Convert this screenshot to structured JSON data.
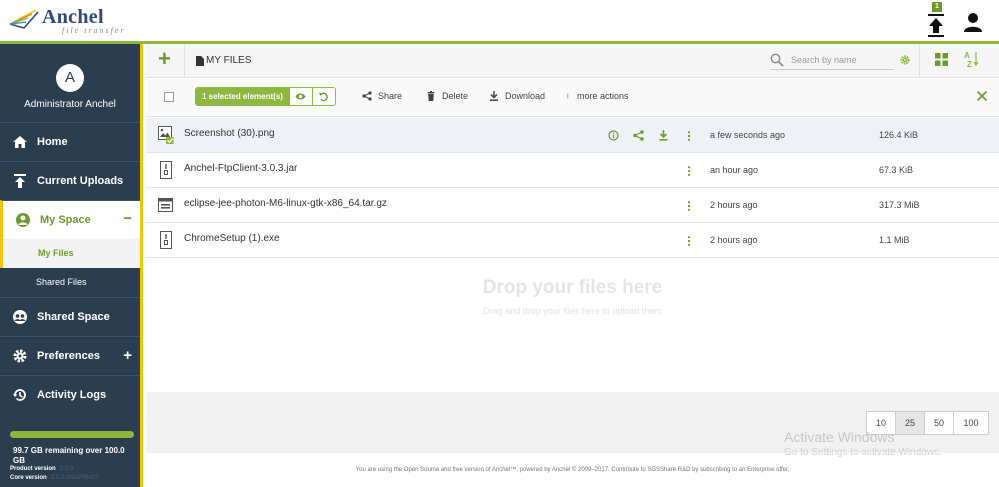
{
  "header": {
    "logo_name": "Anchel",
    "logo_subtitle": "file transfer",
    "upload_badge": "1"
  },
  "sidebar": {
    "avatar_letter": "A",
    "user_name": "Administrator Anchel",
    "items": [
      {
        "label": "Home",
        "icon": "home-icon"
      },
      {
        "label": "Current Uploads",
        "icon": "upload-icon"
      },
      {
        "label": "My Space",
        "icon": "user-circle-icon",
        "active": true
      },
      {
        "label": "Shared Space",
        "icon": "users-icon"
      },
      {
        "label": "Preferences",
        "icon": "gear-icon"
      },
      {
        "label": "Activity Logs",
        "icon": "history-icon"
      }
    ],
    "sub_items": [
      {
        "label": "My Files",
        "active": true
      },
      {
        "label": "Shared Files"
      }
    ],
    "quota_fraction": 1.0,
    "quota_text": "99.7 GB remaining over 100.0 GB",
    "product_version_label": "Product version",
    "product_version_value": "2.0.0",
    "core_version_label": "Core version",
    "core_version_value": "2.0.0-SNAPSHOT"
  },
  "toolbar": {
    "breadcrumb": "MY FILES",
    "search_placeholder": "Search by name"
  },
  "actions": {
    "selected_label": "1 selected element(s)",
    "share": "Share",
    "delete": "Delete",
    "download": "Download",
    "more": "more actions"
  },
  "files": [
    {
      "name": "Screenshot (30).png",
      "date": "a few seconds ago",
      "size": "126.4 KiB",
      "type": "image",
      "selected": true
    },
    {
      "name": "Anchel-FtpClient-3.0.3.jar",
      "date": "an hour ago",
      "size": "67.3 KiB",
      "type": "archive"
    },
    {
      "name": "eclipse-jee-photon-M6-linux-gtk-x86_64.tar.gz",
      "date": "2 hours ago",
      "size": "317.3 MiB",
      "type": "archive-box"
    },
    {
      "name": "ChromeSetup (1).exe",
      "date": "2 hours ago",
      "size": "1.1 MiB",
      "type": "archive"
    }
  ],
  "dropzone": {
    "title": "Drop your files here",
    "subtitle": "Drag and drop your files here to upload them"
  },
  "pager": [
    "10",
    "25",
    "50",
    "100"
  ],
  "pager_active": "25",
  "watermark": {
    "line1": "Activate Windows",
    "line2": "Go to Settings to activate Windows."
  },
  "footer": "You are using the Open Source and free version of Anchel™, powered by Anchel © 2009–2017. Contribute to SGSShare R&D by subscribing to an Enterprise offer.",
  "colors": {
    "accent": "#8fb63e",
    "sidebar": "#2b3e50",
    "highlight": "#f1c40f"
  }
}
